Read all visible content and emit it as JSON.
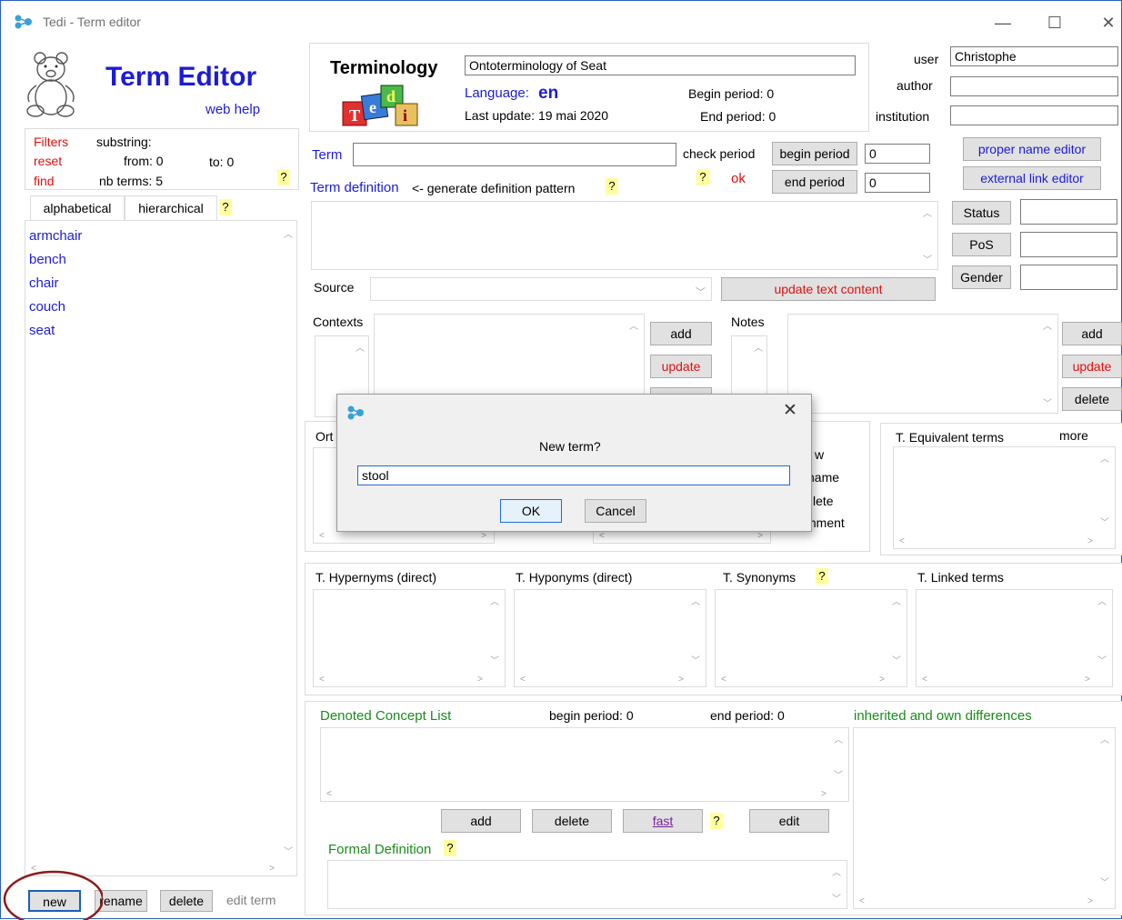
{
  "window": {
    "title": "Tedi - Term editor",
    "minimize": "—",
    "maximize": "☐",
    "close": "✕"
  },
  "header": {
    "app_name": "Term Editor",
    "web_help": "web help"
  },
  "terminology": {
    "label": "Terminology",
    "name": "Ontoterminology of Seat",
    "language_label": "Language:",
    "language_value": "en",
    "last_update": "Last update:  19 mai 2020",
    "begin_period": "Begin period:  0",
    "end_period": "End period:  0"
  },
  "user_info": {
    "user_label": "user",
    "user_value": "Christophe",
    "author_label": "author",
    "author_value": "",
    "institution_label": "institution",
    "institution_value": ""
  },
  "filters": {
    "filters": "Filters",
    "reset": "reset",
    "find": "find",
    "substring": "substring:",
    "from": "from: 0",
    "to": "to:  0",
    "nb_terms": "nb terms: 5",
    "help": "?"
  },
  "tabs": {
    "alphabetical": "alphabetical",
    "hierarchical": "hierarchical",
    "help": "?"
  },
  "terms": [
    "armchair",
    "bench",
    "chair",
    "couch",
    "seat"
  ],
  "bottom_left": {
    "new": "new",
    "rename": "rename",
    "delete": "delete",
    "edit_term": "edit term"
  },
  "term_section": {
    "term_label": "Term",
    "check_period": "check period",
    "begin_period_btn": "begin period",
    "begin_period_val": "0",
    "end_period_btn": "end period",
    "end_period_val": "0",
    "help": "?",
    "ok": "ok",
    "term_definition": "Term definition",
    "generate": "<- generate definition pattern",
    "source": "Source",
    "update_text_content": "update text content",
    "proper_name_editor": "proper name editor",
    "external_link_editor": "external link editor",
    "status": "Status",
    "pos": "PoS",
    "gender": "Gender",
    "contexts": "Contexts",
    "notes": "Notes",
    "add": "add",
    "update": "update",
    "delete": "delete",
    "ort": "Ort",
    "right_frag": [
      "w",
      "name",
      "lete",
      "mment"
    ]
  },
  "equivalent": {
    "label": "T. Equivalent terms",
    "more": "more"
  },
  "relations": {
    "hypernyms": "T. Hypernyms (direct)",
    "hyponyms": "T. Hyponyms (direct)",
    "synonyms": "T. Synonyms",
    "linked": "T. Linked terms",
    "help": "?"
  },
  "concepts": {
    "list_label": "Denoted Concept List",
    "begin_period": "begin period:  0",
    "end_period": "end period: 0",
    "differences": "inherited and own differences",
    "add": "add",
    "delete": "delete",
    "fast": "fast",
    "help": "?",
    "edit": "edit",
    "formal_definition": "Formal Definition"
  },
  "dialog": {
    "prompt": "New term?",
    "value": "stool",
    "ok": "OK",
    "cancel": "Cancel",
    "close": "✕"
  },
  "colors": {
    "blue": "#1c1cd6",
    "red": "#e01010",
    "green": "#1a8c1a",
    "help_bg": "#ffffa0",
    "annotation": "#8b1a1a"
  }
}
